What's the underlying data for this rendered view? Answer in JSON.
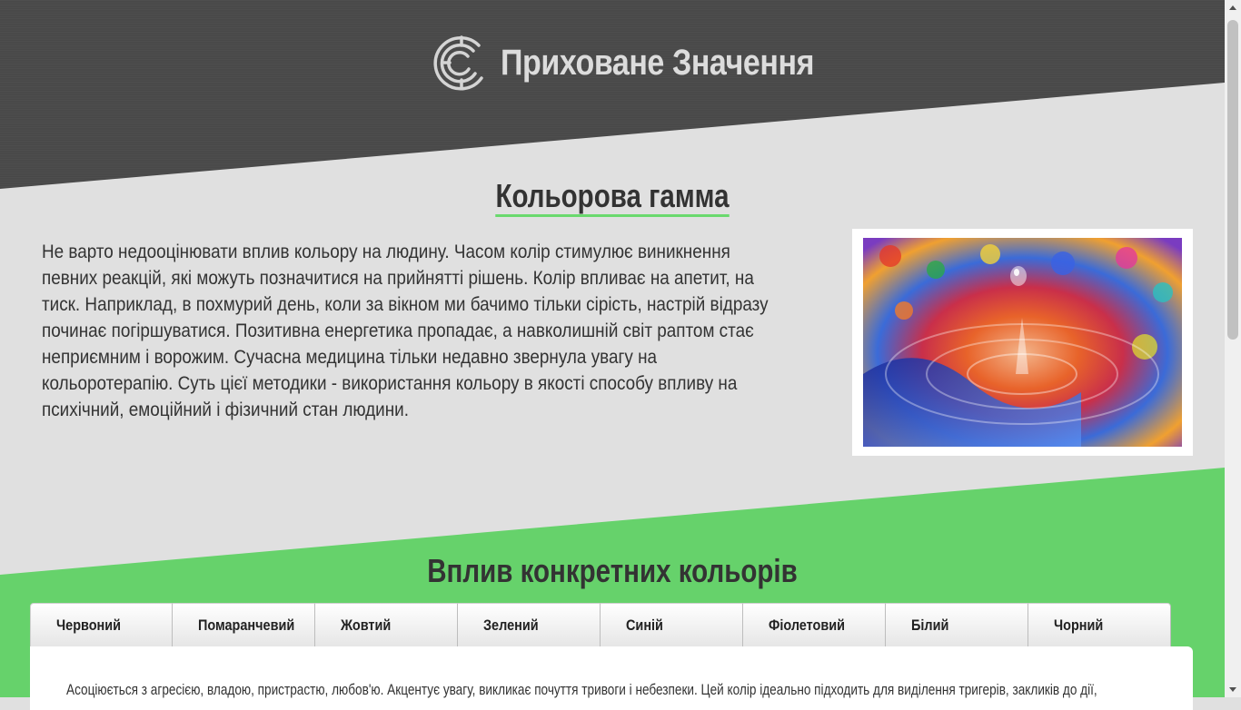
{
  "header": {
    "brand_name": "Приховане Значення",
    "logo_icon": "labyrinth-c-icon"
  },
  "intro_section": {
    "title": "Кольорова гамма",
    "paragraph": "Не варто недооцінювати вплив кольору на людину. Часом колір стимулює виникнення певних реакцій, які можуть позначитися на прийнятті рішень. Колір впливає на апетит, на тиск. Наприклад, в похмурий день, коли за вікном ми бачимо тільки сірість, настрій відразу починає погіршуватися. Позитивна енергетика пропадає, а навколишній світ раптом стає неприємним і ворожим. Сучасна медицина тільки недавно звернула увагу на кольоротерапію. Суть цієї методики - використання кольору в якості способу впливу на психічний, емоційний і фізичний стан людини.",
    "image_icon": "color-water-drop-photo"
  },
  "colors_section": {
    "title": "Вплив конкретних кольорів",
    "tabs": [
      "Червоний",
      "Помаранчевий",
      "Жовтий",
      "Зелений",
      "Синій",
      "Фіолетовий",
      "Білий",
      "Чорний"
    ],
    "active_tab": "Червоний",
    "panel_text": "Асоціюється з агресією, владою, пристрастю, любов'ю. Акцентує увагу, викликає почуття тривоги і небезпеки. Цей колір ідеально підходить для виділення тригерів, закликів до дії,"
  },
  "colors": {
    "header_bg": "#4a4a4a",
    "page_bg": "#e0e0e0",
    "accent_green": "#66d26b",
    "brand_text": "#dcdcdc"
  }
}
